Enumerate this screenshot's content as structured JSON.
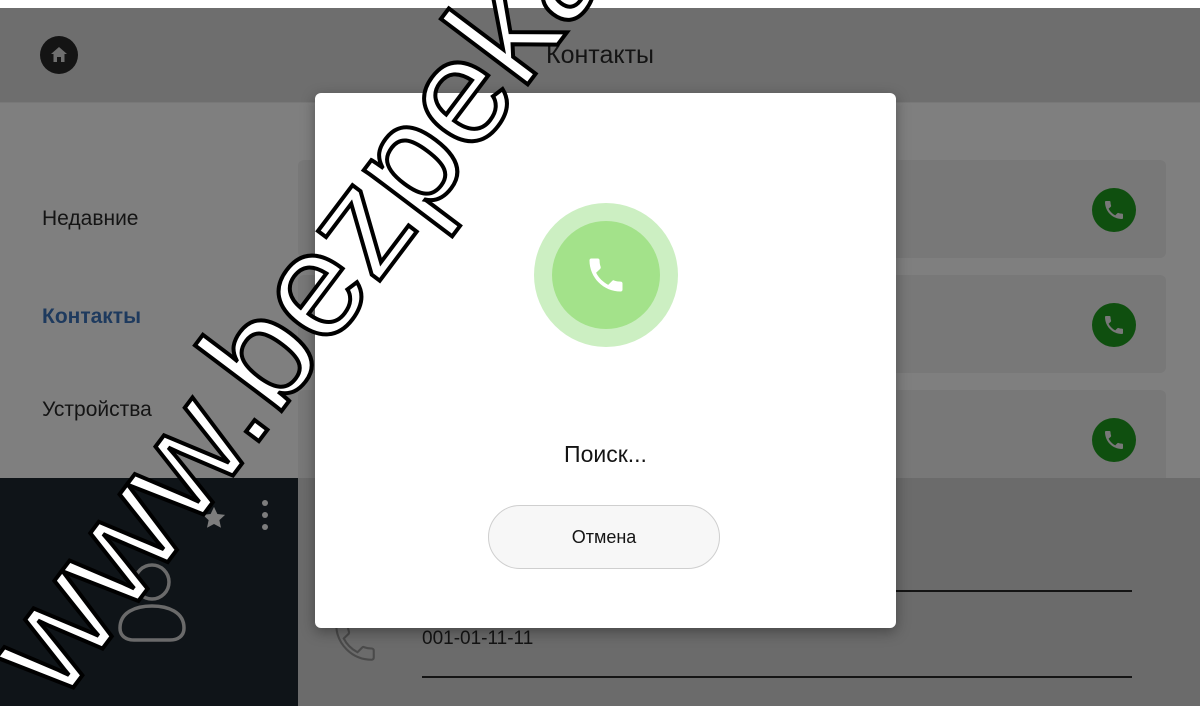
{
  "header": {
    "title": "Контакты",
    "home_icon": "home-icon"
  },
  "nav": {
    "items": [
      {
        "label": "Недавние",
        "active": false
      },
      {
        "label": "Контакты",
        "active": true
      },
      {
        "label": "Устройства",
        "active": false
      }
    ]
  },
  "contacts": {
    "call_icon": "phone-call-icon",
    "call_icon_color": "#0f4f0f"
  },
  "detail": {
    "phone_number": "001-01-11-11",
    "star_icon": "star-icon",
    "more_icon": "more-vertical-icon",
    "avatar_icon": "person-icon"
  },
  "modal": {
    "status": "Поиск...",
    "cancel_label": "Отмена",
    "accent_outer": "#ccefc2",
    "accent_inner": "#a3e28a"
  },
  "watermark": {
    "text": "www.bezpeka-"
  }
}
